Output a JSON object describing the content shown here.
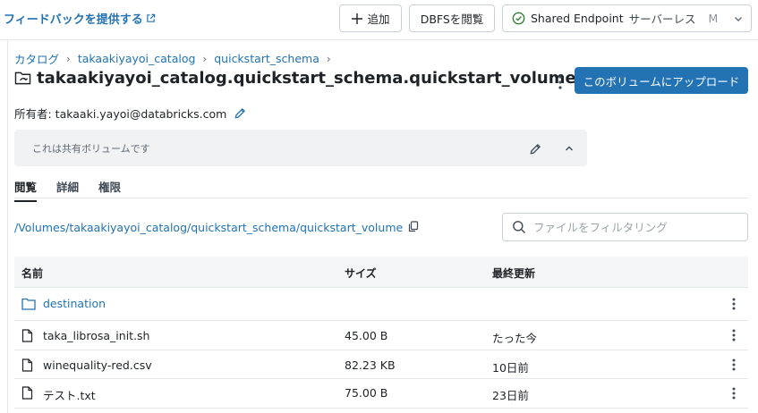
{
  "topbar": {
    "feedback_label": "フィードバックを提供する",
    "add_label": "追加",
    "dbfs_label": "DBFSを閲覧",
    "endpoint_name": "Shared Endpoint",
    "endpoint_type": "サーバーレス",
    "endpoint_size": "M"
  },
  "breadcrumb": {
    "items": [
      "カタログ",
      "takaakiyayoi_catalog",
      "quickstart_schema"
    ],
    "separator": "›"
  },
  "volume": {
    "title": "takaakiyayoi_catalog.quickstart_schema.quickstart_volume",
    "upload_label": "このボリュームにアップロード",
    "owner_label": "所有者: takaaki.yayoi@databricks.com",
    "comment": "これは共有ボリュームです"
  },
  "tabs": [
    {
      "label": "閲覧",
      "active": true
    },
    {
      "label": "詳細",
      "active": false
    },
    {
      "label": "権限",
      "active": false
    }
  ],
  "files": {
    "path": "/Volumes/takaakiyayoi_catalog/quickstart_schema/quickstart_volume",
    "filter_placeholder": "ファイルをフィルタリング",
    "columns": {
      "name": "名前",
      "size": "サイズ",
      "modified": "最終更新"
    },
    "rows": [
      {
        "type": "folder",
        "name": "destination",
        "size": "",
        "modified": ""
      },
      {
        "type": "file",
        "name": "taka_librosa_init.sh",
        "size": "45.00 B",
        "modified": "たった今"
      },
      {
        "type": "file",
        "name": "winequality-red.csv",
        "size": "82.23 KB",
        "modified": "10日前"
      },
      {
        "type": "file",
        "name": "テスト.txt",
        "size": "75.00 B",
        "modified": "23日前"
      }
    ]
  },
  "colors": {
    "accent": "#2272b4",
    "status_ok": "#2e7d32"
  }
}
